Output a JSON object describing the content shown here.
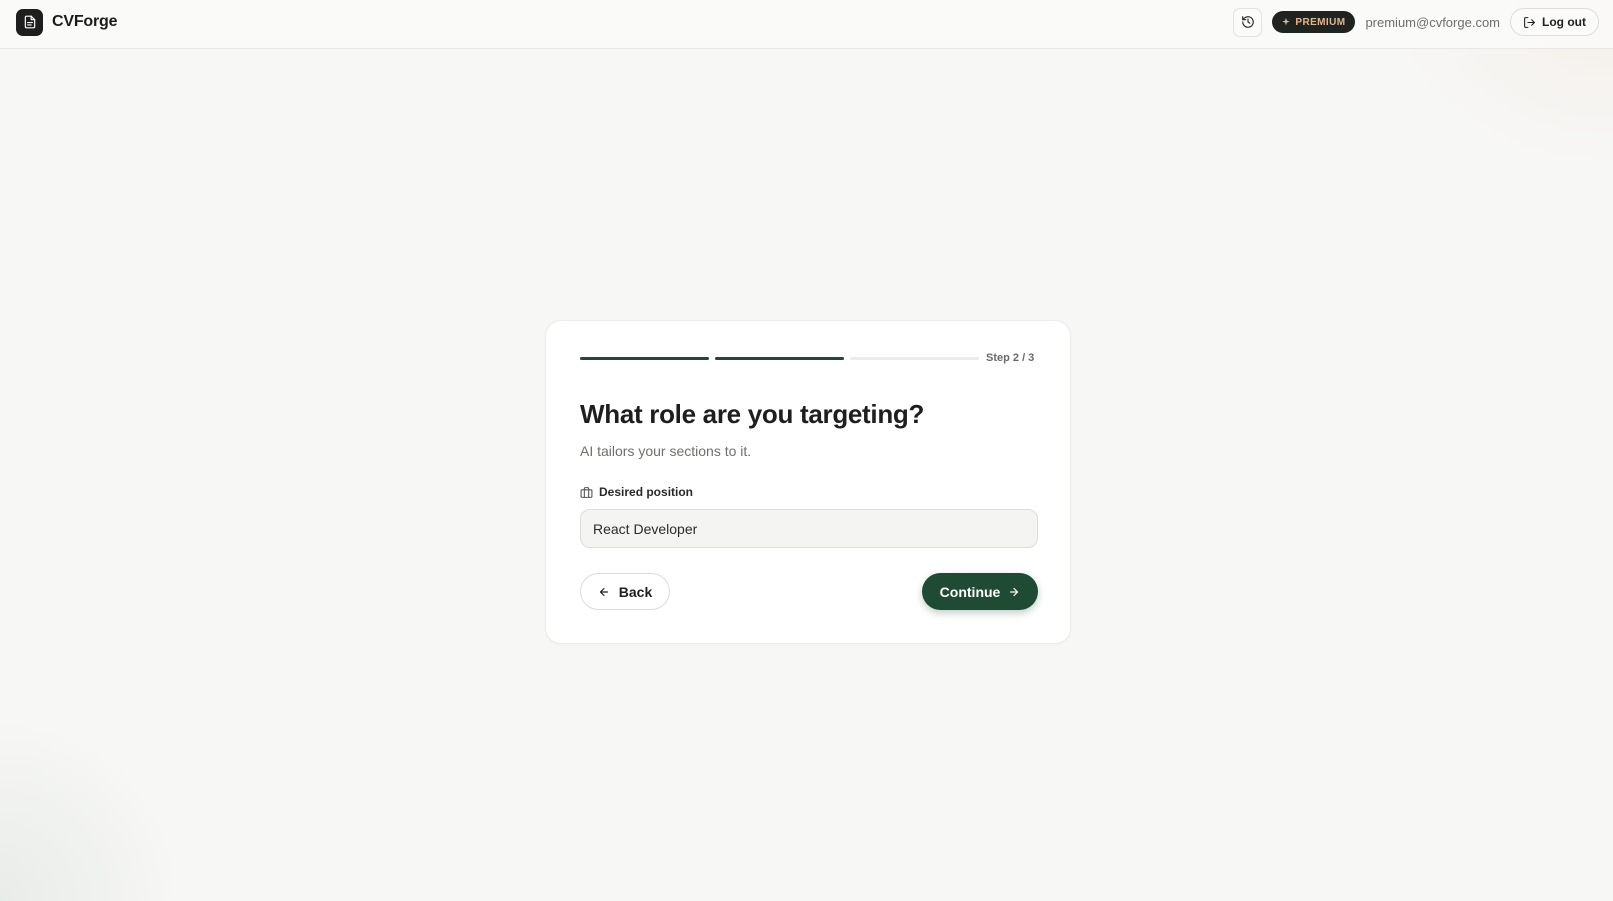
{
  "header": {
    "app_name": "CVForge",
    "premium_label": "PREMIUM",
    "user_email": "premium@cvforge.com",
    "logout_label": "Log out"
  },
  "wizard": {
    "current_step": 2,
    "total_steps": 3,
    "step_label": "Step 2 / 3",
    "title": "What role are you targeting?",
    "subtitle": "AI tailors your sections to it.",
    "field_label": "Desired position",
    "field_value": "React Developer",
    "back_label": "Back",
    "continue_label": "Continue"
  },
  "colors": {
    "accent": "#1f4a33",
    "premium_text": "#e3b692",
    "progress_inactive": "#ebebea"
  },
  "icons": {
    "logo": "document-icon",
    "history": "history-icon",
    "premium": "sparkle-icon",
    "logout": "logout-icon",
    "field": "briefcase-icon",
    "back": "arrow-left-icon",
    "continue": "arrow-right-icon"
  }
}
